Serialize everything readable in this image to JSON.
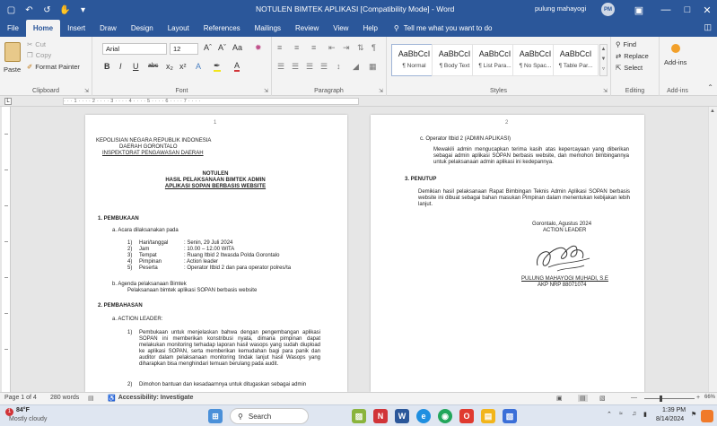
{
  "titlebar": {
    "title": "NOTULEN BIMTEK APLIKASI [Compatibility Mode] - Word",
    "user": "pulung mahayogi",
    "avatar": "PM",
    "quick_access": [
      "save-icon",
      "undo-icon",
      "redo-icon",
      "touch-mode-icon",
      "customize-icon"
    ]
  },
  "menu": {
    "items": [
      "File",
      "Home",
      "Insert",
      "Draw",
      "Design",
      "Layout",
      "References",
      "Mailings",
      "Review",
      "View",
      "Help"
    ],
    "active": "Home",
    "tell_me": "Tell me what you want to do"
  },
  "ribbon": {
    "clipboard": {
      "paste": "Paste",
      "cut": "Cut",
      "copy": "Copy",
      "format_painter": "Format Painter",
      "label": "Clipboard"
    },
    "font": {
      "name": "Arial",
      "size": "12",
      "label": "Font",
      "aa_label": "Aa"
    },
    "paragraph": {
      "label": "Paragraph"
    },
    "styles": {
      "label": "Styles",
      "items": [
        {
          "sample": "AaBbCcI",
          "name": "¶ Normal"
        },
        {
          "sample": "AaBbCcI",
          "name": "¶ Body Text"
        },
        {
          "sample": "AaBbCcI",
          "name": "¶ List Para..."
        },
        {
          "sample": "AaBbCcI",
          "name": "¶ No Spac..."
        },
        {
          "sample": "AaBbCcI",
          "name": "¶ Table Par..."
        }
      ]
    },
    "editing": {
      "find": "Find",
      "replace": "Replace",
      "select": "Select",
      "label": "Editing"
    },
    "addins": {
      "button": "Add-ins",
      "label": "Add-ins"
    }
  },
  "page1": {
    "number": "1",
    "org": [
      "KEPOLISIAN NEGARA REPUBLIK INDONESIA",
      "DAERAH GORONTALO",
      "INSPEKTORAT PENGAWASAN DAERAH"
    ],
    "title": [
      "NOTULEN",
      "HASIL PELAKSANAAN BIMTEK ADMIN",
      "APLIKASI SOPAN BERBASIS WEBSITE"
    ],
    "section1": "1.    PEMBUKAAN",
    "s1a": "a.    Acara dilaksanakan pada",
    "schedule": [
      {
        "n": "1)",
        "k": "Hari/tanggal",
        "v": ": Senin, 29 Juli 2024"
      },
      {
        "n": "2)",
        "k": "Jam",
        "v": ": 10.00 – 12.00 WITA"
      },
      {
        "n": "3)",
        "k": "Tempat",
        "v": ": Ruang Itbid 2 Itwasda Polda Gorontalo"
      },
      {
        "n": "4)",
        "k": "Pimpinan",
        "v": ": Action leader"
      },
      {
        "n": "5)",
        "k": "Peserta",
        "v": ": Operator Itbid 2 dan para operator polres/ta"
      }
    ],
    "s1b": "b.    Agenda pelaksanaan Bimtek",
    "s1b_text": "Pelaksanaan bimtek aplikasi SOPAN berbasis website",
    "section2": "2.    PEMBAHASAN",
    "s2a": "a.    ACTION LEADER:",
    "s2a1_num": "1)",
    "s2a1_text": "Pembukaan untuk menjelaskan bahwa dengan pengembangan aplikasi SOPAN ini memberikan konstribusi nyata, dimana pimpinan dapat melakukan monitoring terhadap laporan hasil wasops yang sudah diupload ke aplikasi SOPAN, serta memberikan kemudahan bagi para panik dan auditor dalam pelaksanaan monitoring tindak lanjut hasil Wasops yang diharapkan bisa menghindari temuan berulang pada audit.",
    "s2a2_num": "2)",
    "s2a2_text": "Dimohon bantuan dan kesadaarnnya untuk ditugaskan sebagai admin"
  },
  "page2": {
    "number": "2",
    "c_head": "c.    Operator Itbid 2 (ADMIN APLIKASI)",
    "c_text": "Mewakili admin mengucapkan terima kasih atas kepercayaan yang diberikan sebagai admin aplikasi SOPAN berbasis website, dan memohon bimbingannya untuk pelaksanaan admin aplikasi ini kedepannya.",
    "section3": "3.    PENUTUP",
    "closing": "Demikian hasil pelaksanaan Rapat Bimbingan Teknis Admin Aplikasi SOPAN berbasis website ini dibuat sebagai bahan masukan Pimpinan dalam menentukan kebijakan lebih lanjut.",
    "place_date": "Gorontalo,   Agustus 2024",
    "role": "ACTION LEADER",
    "signer": "PULUNG MAHAYOGI MUHADI, S.E",
    "rank": "AKP NRP 88071074"
  },
  "status": {
    "page": "Page 1 of 4",
    "words": "280 words",
    "accessibility": "Accessibility: Investigate",
    "zoom": "66%",
    "zoom_level": 0.66
  },
  "taskbar": {
    "temp": "84°F",
    "weather": "Mostly cloudy",
    "search": "Search",
    "time": "1:39 PM",
    "date": "8/14/2024",
    "alert_badge": "1"
  },
  "colors": {
    "word_blue": "#2b579a",
    "ribbon_bg": "#f3f3f3",
    "workspace": "#e6e6e6"
  }
}
